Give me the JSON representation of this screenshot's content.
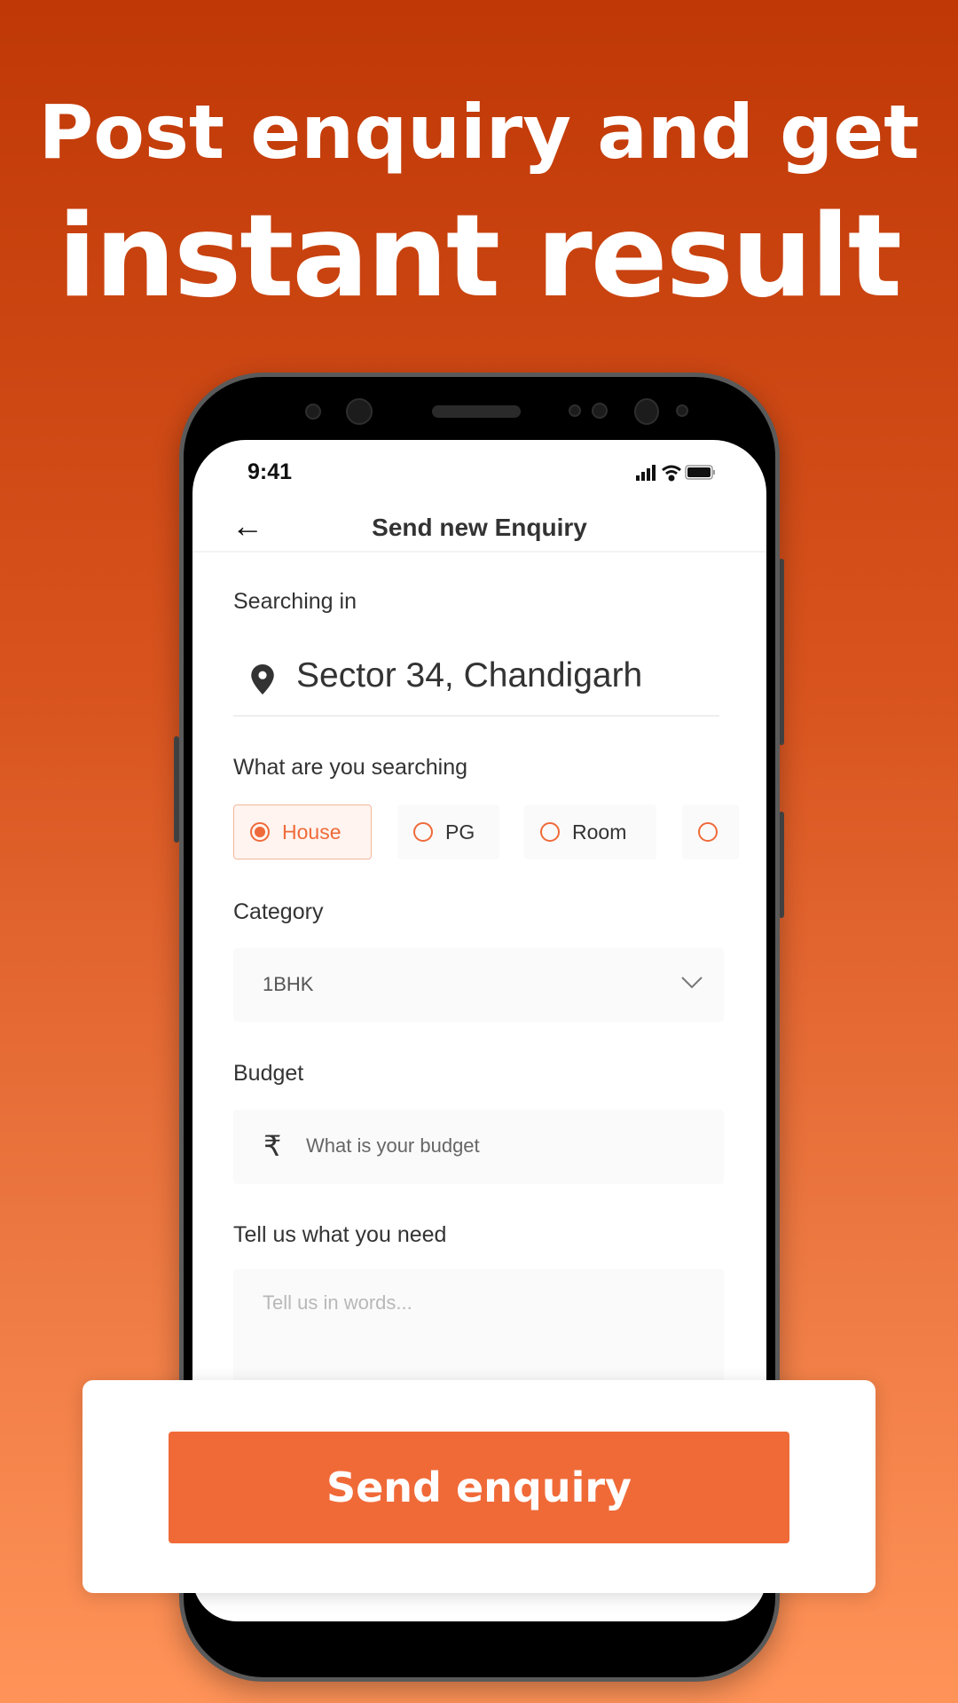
{
  "headline": {
    "line1": "Post enquiry and get",
    "line2": "instant result"
  },
  "status_bar": {
    "time": "9:41"
  },
  "header": {
    "title": "Send new Enquiry",
    "back_icon": "arrow-left-icon"
  },
  "location": {
    "label": "Searching in",
    "value": "Sector 34, Chandigarh",
    "icon": "map-pin-icon"
  },
  "search_type": {
    "label": "What are you searching",
    "options": [
      {
        "label": "House",
        "selected": true
      },
      {
        "label": "PG",
        "selected": false
      },
      {
        "label": "Room",
        "selected": false
      },
      {
        "label": "",
        "selected": false
      }
    ]
  },
  "category": {
    "label": "Category",
    "value": "1BHK",
    "icon": "chevron-down-icon"
  },
  "budget": {
    "label": "Budget",
    "placeholder": "What is your budget",
    "icon": "rupee-icon"
  },
  "needs": {
    "label": "Tell us what you need",
    "placeholder": "Tell us in words..."
  },
  "cta": {
    "label": "Send enquiry"
  },
  "colors": {
    "accent": "#f06a38",
    "bg_top": "#bf3806",
    "bg_bottom": "#ff9358"
  }
}
